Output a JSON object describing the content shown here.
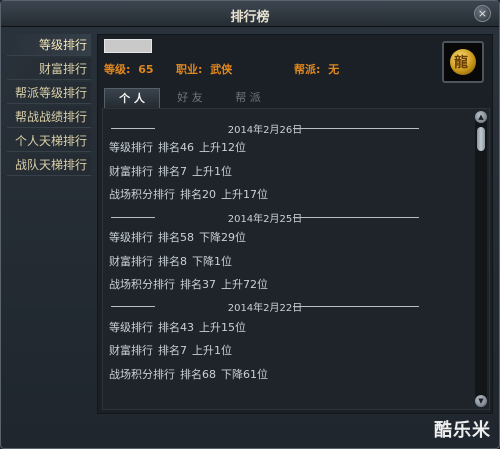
{
  "window": {
    "title": "排行榜",
    "close_label": "×"
  },
  "sidebar": {
    "items": [
      {
        "label": "等级排行"
      },
      {
        "label": "财富排行"
      },
      {
        "label": "帮派等级排行"
      },
      {
        "label": "帮战战绩排行"
      },
      {
        "label": "个人天梯排行"
      },
      {
        "label": "战队天梯排行"
      }
    ]
  },
  "player": {
    "level_label": "等级:",
    "level_value": "65",
    "class_label": "职业:",
    "class_value": "武侠",
    "guild_label": "帮派:",
    "guild_value": "无"
  },
  "tabs": [
    {
      "label": "个  人",
      "active": true
    },
    {
      "label": "好  友",
      "active": false
    },
    {
      "label": "帮  派",
      "active": false
    }
  ],
  "records": [
    {
      "date": "2014年2月26日",
      "rows": [
        {
          "type": "等级排行",
          "rank": "排名46",
          "change": "上升12位"
        },
        {
          "type": "财富排行",
          "rank": "排名7",
          "change": "上升1位"
        },
        {
          "type": "战场积分排行",
          "rank": "排名20",
          "change": "上升17位"
        }
      ]
    },
    {
      "date": "2014年2月25日",
      "rows": [
        {
          "type": "等级排行",
          "rank": "排名58",
          "change": "下降29位"
        },
        {
          "type": "财富排行",
          "rank": "排名8",
          "change": "下降1位"
        },
        {
          "type": "战场积分排行",
          "rank": "排名37",
          "change": "上升72位"
        }
      ]
    },
    {
      "date": "2014年2月22日",
      "rows": [
        {
          "type": "等级排行",
          "rank": "排名43",
          "change": "上升15位"
        },
        {
          "type": "财富排行",
          "rank": "排名7",
          "change": "上升1位"
        },
        {
          "type": "战场积分排行",
          "rank": "排名68",
          "change": "下降61位"
        }
      ]
    }
  ],
  "scroll": {
    "up": "▲",
    "down": "▼"
  },
  "watermark": "酷乐米"
}
